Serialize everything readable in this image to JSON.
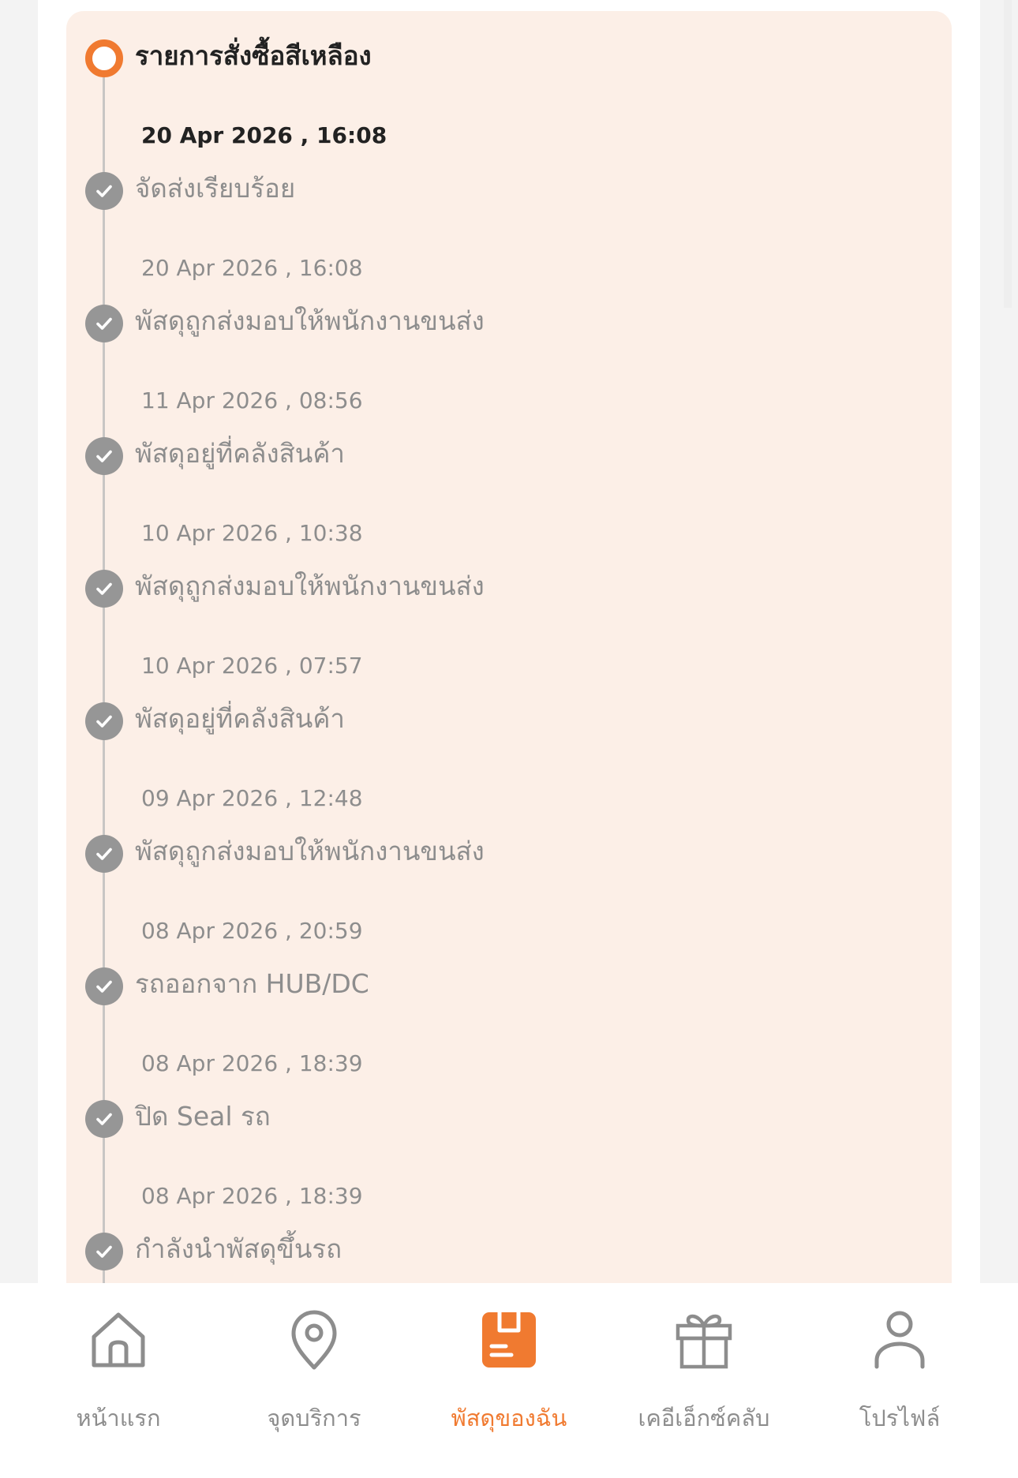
{
  "colors": {
    "accent": "#f07a30",
    "panel_background": "#fcefe7",
    "muted_text": "#8d8d8d",
    "dark_text": "#222222"
  },
  "tracking": {
    "events": [
      {
        "title": "รายการสั่งซื้อสีเหลือง",
        "time": "20 Apr 2026 , 16:08",
        "status": "current"
      },
      {
        "title": "จัดส่งเรียบร้อย",
        "time": "20 Apr 2026 , 16:08",
        "status": "done"
      },
      {
        "title": "พัสดุถูกส่งมอบให้พนักงานขนส่ง",
        "time": "11 Apr 2026 , 08:56",
        "status": "done"
      },
      {
        "title": "พัสดุอยู่ที่คลังสินค้า",
        "time": "10 Apr 2026 , 10:38",
        "status": "done"
      },
      {
        "title": "พัสดุถูกส่งมอบให้พนักงานขนส่ง",
        "time": "10 Apr 2026 , 07:57",
        "status": "done"
      },
      {
        "title": "พัสดุอยู่ที่คลังสินค้า",
        "time": "09 Apr 2026 , 12:48",
        "status": "done"
      },
      {
        "title": "พัสดุถูกส่งมอบให้พนักงานขนส่ง",
        "time": "08 Apr 2026 , 20:59",
        "status": "done"
      },
      {
        "title": "รถออกจาก HUB/DC",
        "time": "08 Apr 2026 , 18:39",
        "status": "done"
      },
      {
        "title": "ปิด Seal รถ",
        "time": "08 Apr 2026 , 18:39",
        "status": "done"
      },
      {
        "title": "กำลังนำพัสดุขึ้นรถ",
        "time": "",
        "status": "done"
      }
    ]
  },
  "bottom_nav": {
    "items": [
      {
        "label": "หน้าแรก",
        "icon": "home-icon",
        "active": false
      },
      {
        "label": "จุดบริการ",
        "icon": "location-pin-icon",
        "active": false
      },
      {
        "label": "พัสดุของฉัน",
        "icon": "parcel-icon",
        "active": true
      },
      {
        "label": "เคอีเอ็กซ์คลับ",
        "icon": "gift-icon",
        "active": false
      },
      {
        "label": "โปรไฟล์",
        "icon": "profile-icon",
        "active": false
      }
    ]
  }
}
